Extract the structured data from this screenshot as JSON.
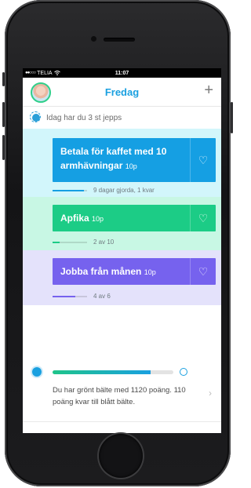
{
  "status_bar": {
    "carrier": "TELIA",
    "time": "11:07"
  },
  "nav": {
    "title": "Fredag"
  },
  "notice": {
    "text": "Idag har du 3 st jepps"
  },
  "tasks": [
    {
      "title": "Betala för kaffet med 10 armhävningar",
      "points": "10p",
      "progress_text": "9 dagar gjorda, 1 kvar",
      "progress": 0.9,
      "colors": {
        "section": "#d2f6fb",
        "card": "#159fe3",
        "fill": "#159fe3"
      }
    },
    {
      "title": "Apfika",
      "points": "10p",
      "progress_text": "2 av 10",
      "progress": 0.2,
      "colors": {
        "section": "#c8f7e4",
        "card": "#1ccc86",
        "fill": "#1ccc86"
      }
    },
    {
      "title": "Jobba från månen",
      "points": "10p",
      "progress_text": "4 av 6",
      "progress": 0.67,
      "colors": {
        "section": "#e4e2fb",
        "card": "#7662ee",
        "fill": "#7662ee"
      }
    }
  ],
  "belt": {
    "text": "Du har grönt bälte med 1120 poäng. 110 poäng kvar till blått bälte.",
    "progress": 0.81
  },
  "icons": [
    "wifi-icon",
    "sun-icon",
    "plus-icon",
    "heart-icon",
    "chevron-right-icon",
    "belt-dot-icon",
    "belt-goal-icon"
  ]
}
